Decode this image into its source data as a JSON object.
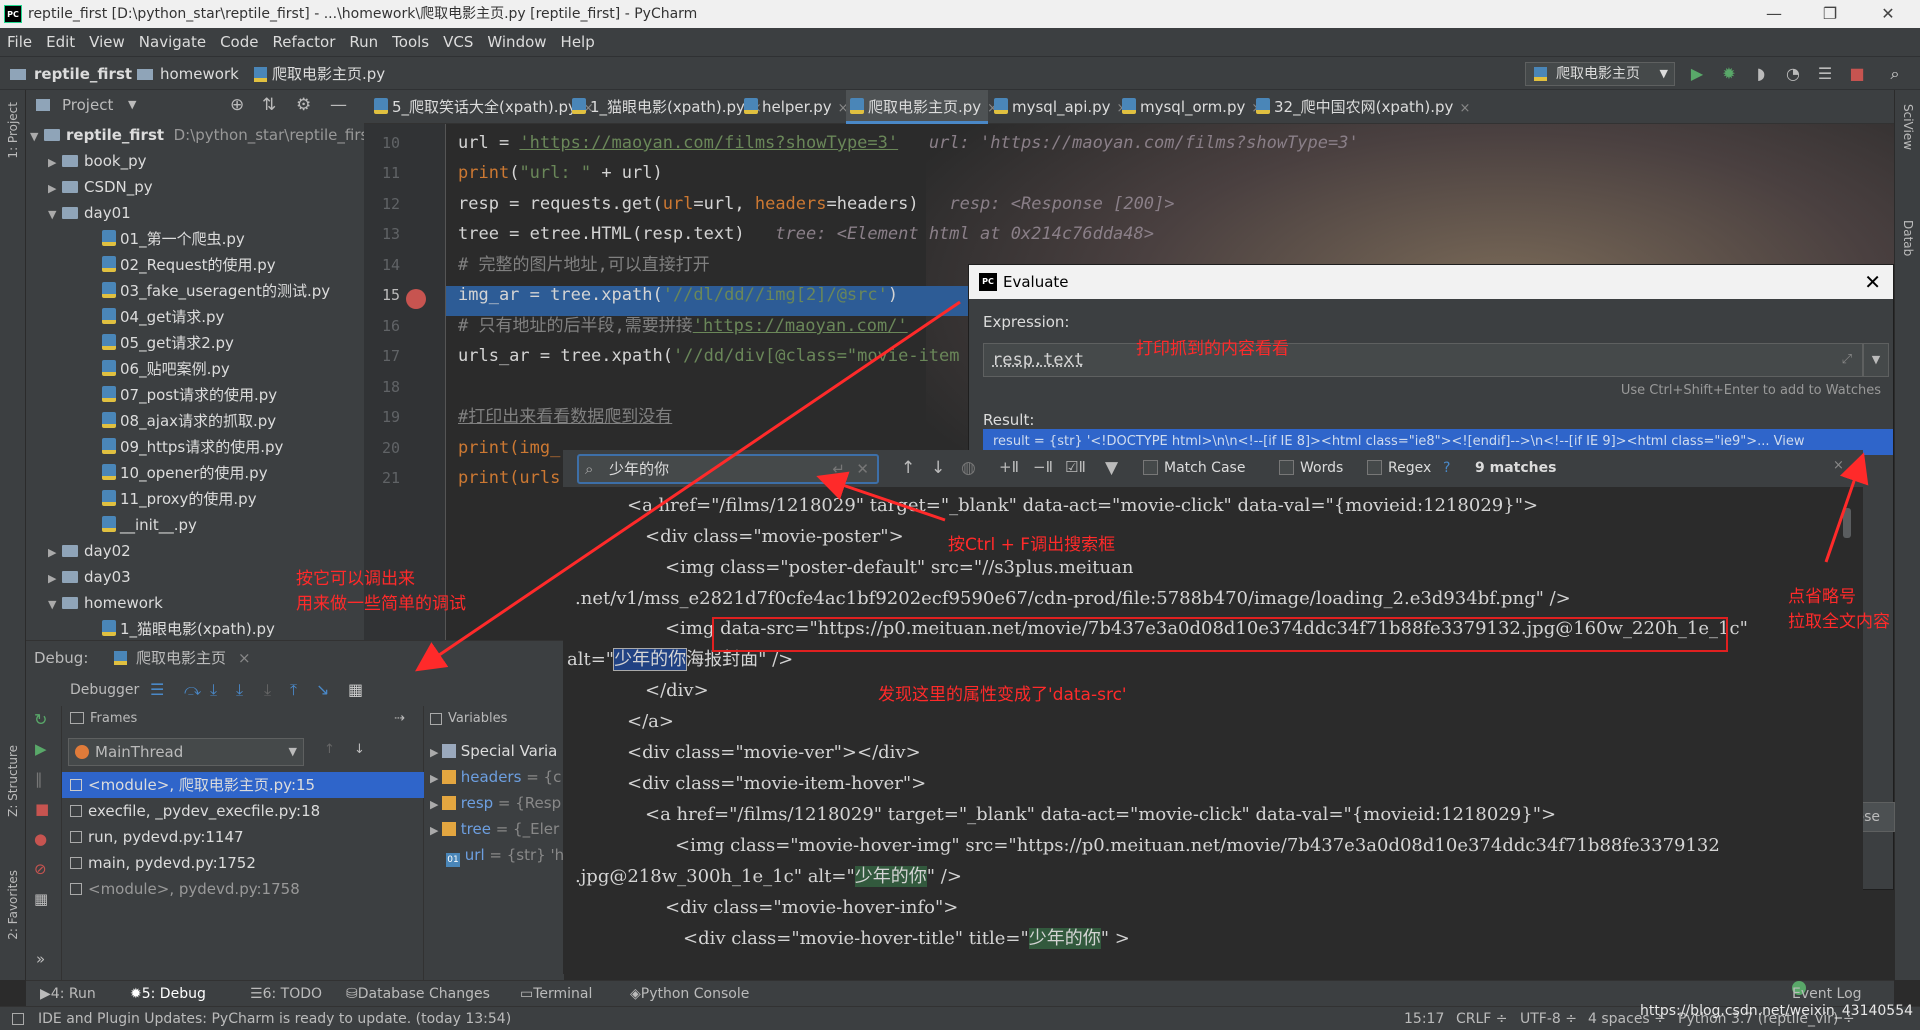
{
  "window": {
    "title": "reptile_first [D:\\python_star\\reptile_first] - ...\\homework\\爬取电影主页.py [reptile_first] - PyCharm",
    "logo": "PC"
  },
  "menu": [
    "File",
    "Edit",
    "View",
    "Navigate",
    "Code",
    "Refactor",
    "Run",
    "Tools",
    "VCS",
    "Window",
    "Help"
  ],
  "navbar": {
    "project": "reptile_first",
    "folder": "homework",
    "file": "爬取电影主页.py",
    "run_config": "爬取电影主页"
  },
  "project_panel": {
    "title": "Project",
    "root_label": "reptile_first",
    "root_path": "D:\\python_star\\reptile_first",
    "items": [
      {
        "label": "book_py",
        "type": "folder",
        "state": "collapsed"
      },
      {
        "label": "CSDN_py",
        "type": "folder",
        "state": "collapsed"
      },
      {
        "label": "day01",
        "type": "folder",
        "state": "expanded"
      },
      {
        "label": "01_第一个爬虫.py",
        "type": "file"
      },
      {
        "label": "02_Request的使用.py",
        "type": "file"
      },
      {
        "label": "03_fake_useragent的测试.py",
        "type": "file"
      },
      {
        "label": "04_get请求.py",
        "type": "file"
      },
      {
        "label": "05_get请求2.py",
        "type": "file"
      },
      {
        "label": "06_贴吧案例.py",
        "type": "file"
      },
      {
        "label": "07_post请求的使用.py",
        "type": "file"
      },
      {
        "label": "08_ajax请求的抓取.py",
        "type": "file"
      },
      {
        "label": "09_https请求的使用.py",
        "type": "file"
      },
      {
        "label": "10_opener的使用.py",
        "type": "file"
      },
      {
        "label": "11_proxy的使用.py",
        "type": "file"
      },
      {
        "label": "__init__.py",
        "type": "file"
      },
      {
        "label": "day02",
        "type": "folder",
        "state": "collapsed"
      },
      {
        "label": "day03",
        "type": "folder",
        "state": "collapsed"
      },
      {
        "label": "homework",
        "type": "folder",
        "state": "expanded"
      },
      {
        "label": "1_猫眼电影(xpath).py",
        "type": "file"
      }
    ]
  },
  "tabs": [
    {
      "label": "5_爬取笑话大全(xpath).py",
      "active": false
    },
    {
      "label": "1_猫眼电影(xpath).py",
      "active": false
    },
    {
      "label": "helper.py",
      "active": false
    },
    {
      "label": "爬取电影主页.py",
      "active": true
    },
    {
      "label": "mysql_api.py",
      "active": false
    },
    {
      "label": "mysql_orm.py",
      "active": false
    },
    {
      "label": "32_爬中国农网(xpath).py",
      "active": false
    }
  ],
  "editor": {
    "line_numbers": [
      "10",
      "11",
      "12",
      "13",
      "14",
      "15",
      "16",
      "17",
      "18",
      "19",
      "20",
      "21"
    ],
    "breakpoint_line": "15",
    "line10": {
      "a": "url = ",
      "s": "'https://maoyan.com/films?showType=3'",
      "hint": "url: 'https://maoyan.com/films?showType=3'"
    },
    "line11": {
      "a": "print",
      "b": "(",
      "s": "\"url: \"",
      "c": " + url)"
    },
    "line12": {
      "a": "resp = requests.get(",
      "k1": "url",
      "b": "=url, ",
      "k2": "headers",
      "c": "=headers)",
      "hint": "resp: <Response [200]>"
    },
    "line13": {
      "a": "tree = etree.HTML(resp.text)",
      "hint": "tree: <Element html at 0x214c76dda48>"
    },
    "line14": {
      "cm": "# 完整的图片地址,可以直接打开"
    },
    "line15": {
      "a": "img_ar = tree.xpath(",
      "s": "'//dl/dd//img[2]/@src'",
      "b": ")"
    },
    "line16": {
      "cm": "# 只有地址的后半段,需要拼接",
      "s": "'https://maoyan.com/'"
    },
    "line17": {
      "a": "urls_ar = tree.xpath(",
      "s": "'//dd/div[@class=\"movie-item f"
    },
    "line19": {
      "cm": "#打印出来看看数据爬到没有"
    },
    "line20": {
      "a": "print(img_"
    },
    "line21": {
      "a": "print(urls"
    }
  },
  "evaluate": {
    "title": "Evaluate",
    "expression_label": "Expression:",
    "expression": "resp.text",
    "hint": "Use Ctrl+Shift+Enter to add to Watches",
    "result_label": "Result:",
    "result_line": "result = {str} '<!DOCTYPE html>\\n\\n<!--[if IE 8]><html class=\"ie8\"><![endif]-->\\n<!--[if IE 9]><html class=\"ie9\">... View",
    "close_label": "ose"
  },
  "search": {
    "query": "少年的你",
    "match_case": "Match Case",
    "words": "Words",
    "regex": "Regex",
    "help": "?",
    "matches": "9 matches"
  },
  "result_text": [
    "<a href=\"/films/1218029\" target=\"_blank\" data-act=\"movie-click\" data-val=\"{movieid:1218029}\">",
    "<div class=\"movie-poster\">",
    "<img class=\"poster-default\" src=\"//s3plus.meituan",
    ".net/v1/mss_e2821d7f0cfe4ac1bf9202ecf9590e67/cdn-prod/file:5788b470/image/loading_2.e3d934bf.png\" />",
    "<img ",
    "data-src=\"https://p0.meituan.net/movie/7b437e3a0d08d10e374ddc34f71b88fe3379132.jpg@160w_220h_1e_1c\" ",
    "alt=\"",
    "少年的你",
    "海报封面\" />",
    "</div>",
    "</a>",
    "<div class=\"movie-ver\"></div>",
    "<div class=\"movie-item-hover\">",
    "<a href=\"/films/1218029\" target=\"_blank\" data-act=\"movie-click\" data-val=\"{movieid:1218029}\">",
    "<img class=\"movie-hover-img\" src=\"https://p0.meituan.net/movie/7b437e3a0d08d10e374ddc34f71b88fe3379132",
    ".jpg@218w_300h_1e_1c\" alt=\"",
    "少年的你",
    "\" />",
    "<div class=\"movie-hover-info\">",
    "<div class=\"movie-hover-title\" title=\"",
    "少年的你",
    "\" >"
  ],
  "debug": {
    "label": "Debug:",
    "session": "爬取电影主页",
    "debugger_tab": "Debugger",
    "frames_label": "Frames",
    "variables_label": "Variables",
    "thread": "MainThread",
    "frames": [
      "<module>, 爬取电影主页.py:15",
      "execfile, _pydev_execfile.py:18",
      "run, pydevd.py:1147",
      "main, pydevd.py:1752",
      "<module>, pydevd.py:1758"
    ],
    "variables": [
      {
        "name": "Special Varia",
        "value": ""
      },
      {
        "name": "headers",
        "value": " = {c"
      },
      {
        "name": "resp",
        "value": " = {Resp"
      },
      {
        "name": "tree",
        "value": " = {_Eler"
      },
      {
        "name": "url",
        "value": " = {str} 'ht"
      }
    ]
  },
  "bottom_tabs": [
    "4: Run",
    "5: Debug",
    "6: TODO",
    "Database Changes",
    "Terminal",
    "Python Console"
  ],
  "event_log": "Event Log",
  "left_strip": {
    "project": "1: Project",
    "structure": "Z: Structure",
    "favorites": "2: Favorites"
  },
  "right_strip": {
    "sciview": "SciView",
    "database": "Datab"
  },
  "status": {
    "message": "IDE and Plugin Updates: PyCharm is ready to update. (today 13:54)",
    "position": "15:17",
    "line_sep": "CRLF ÷",
    "encoding": "UTF-8 ÷",
    "indent": "4 spaces ÷",
    "interpreter": "Python 3.7 (reptile_vir) ÷",
    "watermark": "https://blog.csdn.net/weixin_43140554"
  },
  "annotations": {
    "a1": "打印抓到的内容看看",
    "a2": "按Ctrl + F调出搜索框",
    "a3": "发现这里的属性变成了'data-src'",
    "a4_l1": "点省略号",
    "a4_l2": "拉取全文内容",
    "a5_l1": "按它可以调出来",
    "a5_l2": "用来做一些简单的调试"
  },
  "colors": {
    "accent": "#2f65ca",
    "annotation": "#ff2a2a",
    "editor_bg": "#2b2b2b",
    "panel_bg": "#3c3f41"
  }
}
